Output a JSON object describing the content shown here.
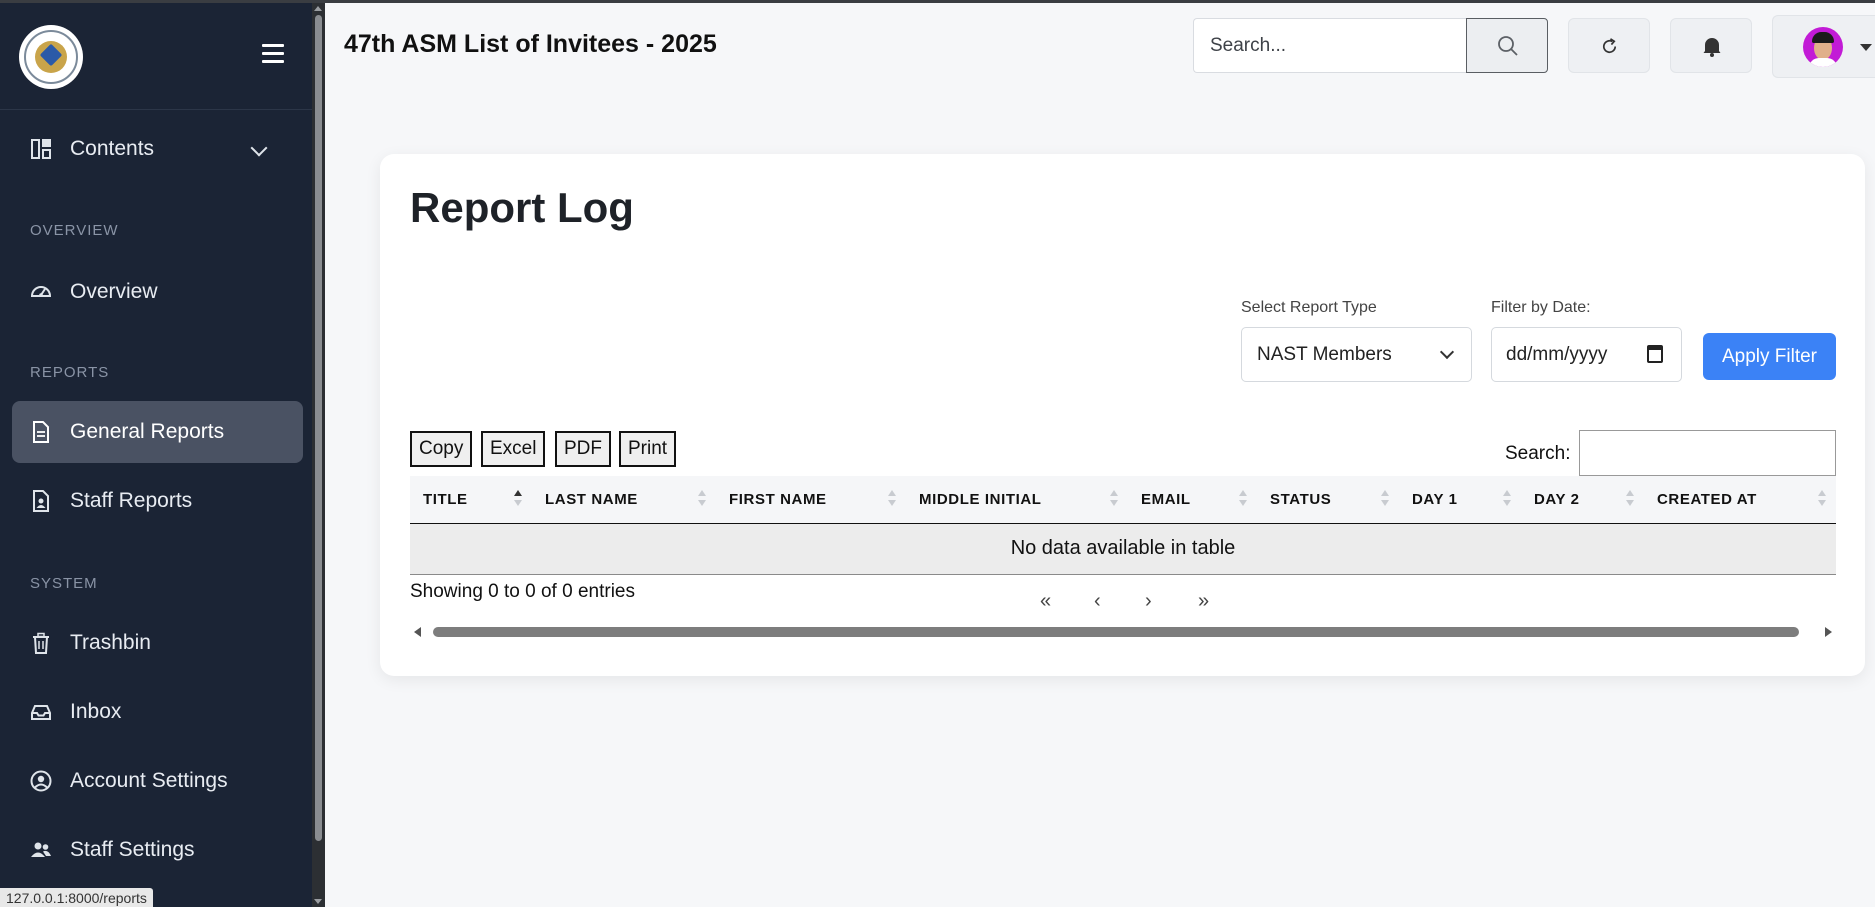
{
  "app": {
    "title": "47th ASM List of Invitees - 2025"
  },
  "header": {
    "search_placeholder": "Search..."
  },
  "sidebar": {
    "contents_label": "Contents",
    "sections": {
      "overview": "OVERVIEW",
      "reports": "REPORTS",
      "system": "SYSTEM"
    },
    "items": {
      "overview": "Overview",
      "general_reports": "General Reports",
      "staff_reports": "Staff Reports",
      "trashbin": "Trashbin",
      "inbox": "Inbox",
      "account_settings": "Account Settings",
      "staff_settings": "Staff Settings"
    },
    "active_item": "General Reports"
  },
  "status_url": "127.0.0.1:8000/reports",
  "main": {
    "title": "Report Log",
    "filters": {
      "report_type_label": "Select Report Type",
      "report_type_value": "NAST Members",
      "date_label": "Filter by Date:",
      "date_value": "dd/mm/yyyy",
      "apply_label": "Apply Filter"
    },
    "export_buttons": [
      "Copy",
      "Excel",
      "PDF",
      "Print"
    ],
    "table_search_label": "Search:",
    "table": {
      "columns": [
        "TITLE",
        "LAST NAME",
        "FIRST NAME",
        "MIDDLE INITIAL",
        "EMAIL",
        "STATUS",
        "DAY 1",
        "DAY 2",
        "CREATED AT"
      ],
      "empty_message": "No data available in table"
    },
    "info_text": "Showing 0 to 0 of 0 entries",
    "pagination": {
      "first": "«",
      "prev": "‹",
      "next": "›",
      "last": "»"
    }
  },
  "colors": {
    "sidebar_bg": "#1b2435",
    "active_item_bg": "#4a5263",
    "accent": "#3b82f6"
  }
}
